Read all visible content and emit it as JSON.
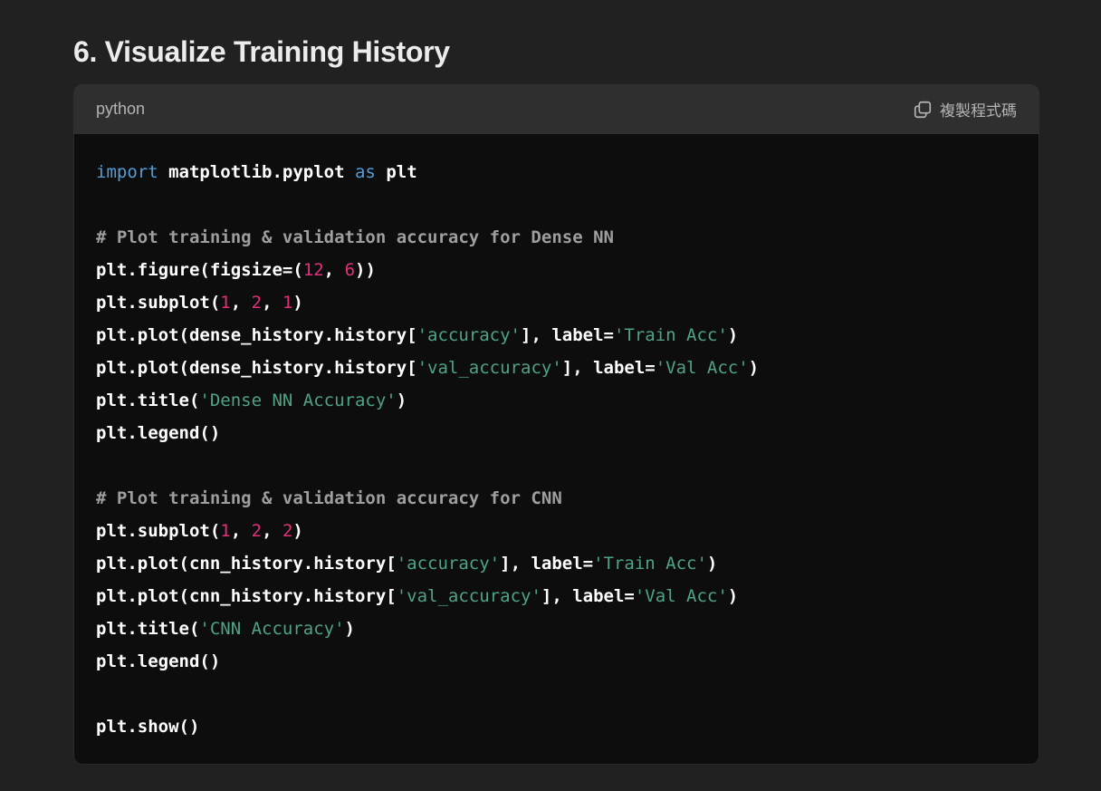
{
  "heading": "6. Visualize Training History",
  "code_block": {
    "language": "python",
    "copy_label": "複製程式碼",
    "copy_icon": "copy-icon",
    "colors": {
      "keyword": "#569cd6",
      "number": "#df3079",
      "string": "#4ea383",
      "comment": "#9e9e9e",
      "plain": "#ffffff"
    },
    "lines": [
      [
        {
          "t": "keyword",
          "v": "import"
        },
        {
          "t": "plain",
          "v": " matplotlib.pyplot "
        },
        {
          "t": "keyword",
          "v": "as"
        },
        {
          "t": "plain",
          "v": " plt"
        }
      ],
      [],
      [
        {
          "t": "comment",
          "v": "# Plot training & validation accuracy for Dense NN"
        }
      ],
      [
        {
          "t": "plain",
          "v": "plt.figure(figsize=("
        },
        {
          "t": "number",
          "v": "12"
        },
        {
          "t": "plain",
          "v": ", "
        },
        {
          "t": "number",
          "v": "6"
        },
        {
          "t": "plain",
          "v": "))"
        }
      ],
      [
        {
          "t": "plain",
          "v": "plt.subplot("
        },
        {
          "t": "number",
          "v": "1"
        },
        {
          "t": "plain",
          "v": ", "
        },
        {
          "t": "number",
          "v": "2"
        },
        {
          "t": "plain",
          "v": ", "
        },
        {
          "t": "number",
          "v": "1"
        },
        {
          "t": "plain",
          "v": ")"
        }
      ],
      [
        {
          "t": "plain",
          "v": "plt.plot(dense_history.history["
        },
        {
          "t": "string",
          "v": "'accuracy'"
        },
        {
          "t": "plain",
          "v": "], label="
        },
        {
          "t": "string",
          "v": "'Train Acc'"
        },
        {
          "t": "plain",
          "v": ")"
        }
      ],
      [
        {
          "t": "plain",
          "v": "plt.plot(dense_history.history["
        },
        {
          "t": "string",
          "v": "'val_accuracy'"
        },
        {
          "t": "plain",
          "v": "], label="
        },
        {
          "t": "string",
          "v": "'Val Acc'"
        },
        {
          "t": "plain",
          "v": ")"
        }
      ],
      [
        {
          "t": "plain",
          "v": "plt.title("
        },
        {
          "t": "string",
          "v": "'Dense NN Accuracy'"
        },
        {
          "t": "plain",
          "v": ")"
        }
      ],
      [
        {
          "t": "plain",
          "v": "plt.legend()"
        }
      ],
      [],
      [
        {
          "t": "comment",
          "v": "# Plot training & validation accuracy for CNN"
        }
      ],
      [
        {
          "t": "plain",
          "v": "plt.subplot("
        },
        {
          "t": "number",
          "v": "1"
        },
        {
          "t": "plain",
          "v": ", "
        },
        {
          "t": "number",
          "v": "2"
        },
        {
          "t": "plain",
          "v": ", "
        },
        {
          "t": "number",
          "v": "2"
        },
        {
          "t": "plain",
          "v": ")"
        }
      ],
      [
        {
          "t": "plain",
          "v": "plt.plot(cnn_history.history["
        },
        {
          "t": "string",
          "v": "'accuracy'"
        },
        {
          "t": "plain",
          "v": "], label="
        },
        {
          "t": "string",
          "v": "'Train Acc'"
        },
        {
          "t": "plain",
          "v": ")"
        }
      ],
      [
        {
          "t": "plain",
          "v": "plt.plot(cnn_history.history["
        },
        {
          "t": "string",
          "v": "'val_accuracy'"
        },
        {
          "t": "plain",
          "v": "], label="
        },
        {
          "t": "string",
          "v": "'Val Acc'"
        },
        {
          "t": "plain",
          "v": ")"
        }
      ],
      [
        {
          "t": "plain",
          "v": "plt.title("
        },
        {
          "t": "string",
          "v": "'CNN Accuracy'"
        },
        {
          "t": "plain",
          "v": ")"
        }
      ],
      [
        {
          "t": "plain",
          "v": "plt.legend()"
        }
      ],
      [],
      [
        {
          "t": "plain",
          "v": "plt.show()"
        }
      ]
    ]
  }
}
